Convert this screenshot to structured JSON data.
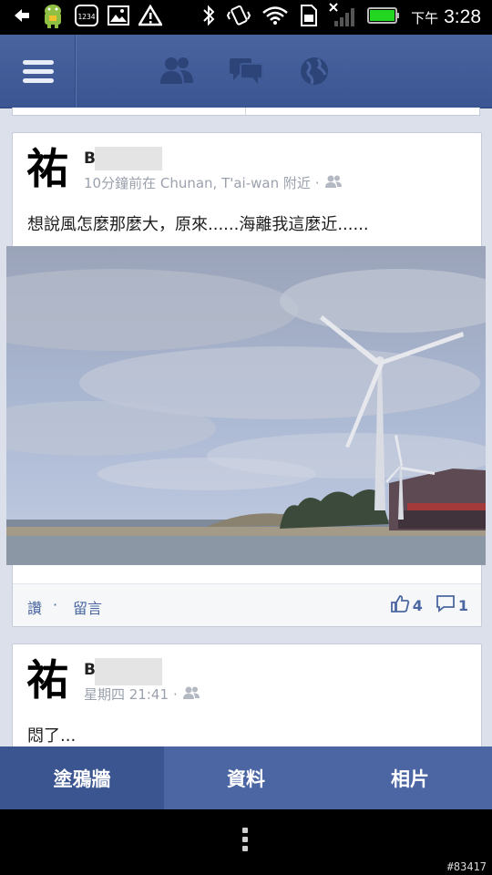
{
  "status_bar": {
    "am_pm": "下午",
    "time": "3:28",
    "mini_icon_text": "1234"
  },
  "nav": {
    "icons": [
      "menu-icon",
      "friends-icon",
      "messages-icon",
      "globe-icon"
    ]
  },
  "posts": [
    {
      "avatar_char": "祐",
      "author_initial": "B",
      "time_location": "10分鐘前在 Chunan, T'ai-wan 附近",
      "separator": "·",
      "text": "想說風怎麼那麼大，原來......海離我這麼近......",
      "like_label": "讚",
      "comment_label": "留言",
      "dot": "·",
      "like_count": "4",
      "comment_count": "1"
    },
    {
      "avatar_char": "祐",
      "author_initial": "B",
      "time_location": "星期四 21:41",
      "separator": "·",
      "text": "悶了..."
    }
  ],
  "tabs": [
    {
      "label": "塗鴉牆",
      "active": true
    },
    {
      "label": "資料",
      "active": false
    },
    {
      "label": "相片",
      "active": false
    }
  ],
  "watermark": "#83417",
  "colors": {
    "nav_blue": "#3b5592",
    "tab_active": "#3b5591",
    "tab_bg": "#4c66a4",
    "link_blue": "#4b67a1"
  }
}
